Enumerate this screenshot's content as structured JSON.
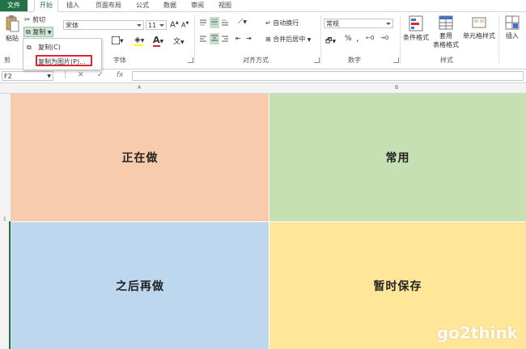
{
  "tabs": [
    "文件",
    "开始",
    "插入",
    "页面布局",
    "公式",
    "数据",
    "审阅",
    "视图"
  ],
  "clipboard": {
    "paste_label": "粘贴",
    "cut_label": "剪切",
    "copy_label": "复制",
    "group_label": "剪"
  },
  "paste_menu": {
    "item_copy": "复制(C)",
    "item_copy_picture": "复制为图片(P)..."
  },
  "font": {
    "font_name": "宋体",
    "font_size": "11",
    "group_label": "字体",
    "bold": "B",
    "grow": "A",
    "shrink": "A"
  },
  "alignment": {
    "wrap_text": "自动换行",
    "merge_center": "合并后居中",
    "group_label": "对齐方式"
  },
  "number": {
    "format": "常规",
    "group_label": "数字",
    "percent": "%",
    "comma": ","
  },
  "styles": {
    "conditional": "条件格式",
    "table_format_1": "套用",
    "table_format_2": "表格格式",
    "cell_styles": "单元格样式",
    "group_label": "样式"
  },
  "cells": {
    "insert": "插入"
  },
  "formula_bar": {
    "name_box": "F2",
    "cancel": "✕",
    "enter": "✓",
    "fx": "fx"
  },
  "sheet": {
    "col_a": "A",
    "col_b": "B",
    "row_1": "1",
    "quadrants": [
      {
        "text": "正在做",
        "color": "#f8cbad"
      },
      {
        "text": "常用",
        "color": "#c6e0b4"
      },
      {
        "text": "之后再做",
        "color": "#bdd7ee"
      },
      {
        "text": "暂时保存",
        "color": "#ffe699"
      }
    ]
  },
  "watermark": "go2think",
  "colors": {
    "accent": "#217346",
    "highlight_border": "#d9262f"
  }
}
